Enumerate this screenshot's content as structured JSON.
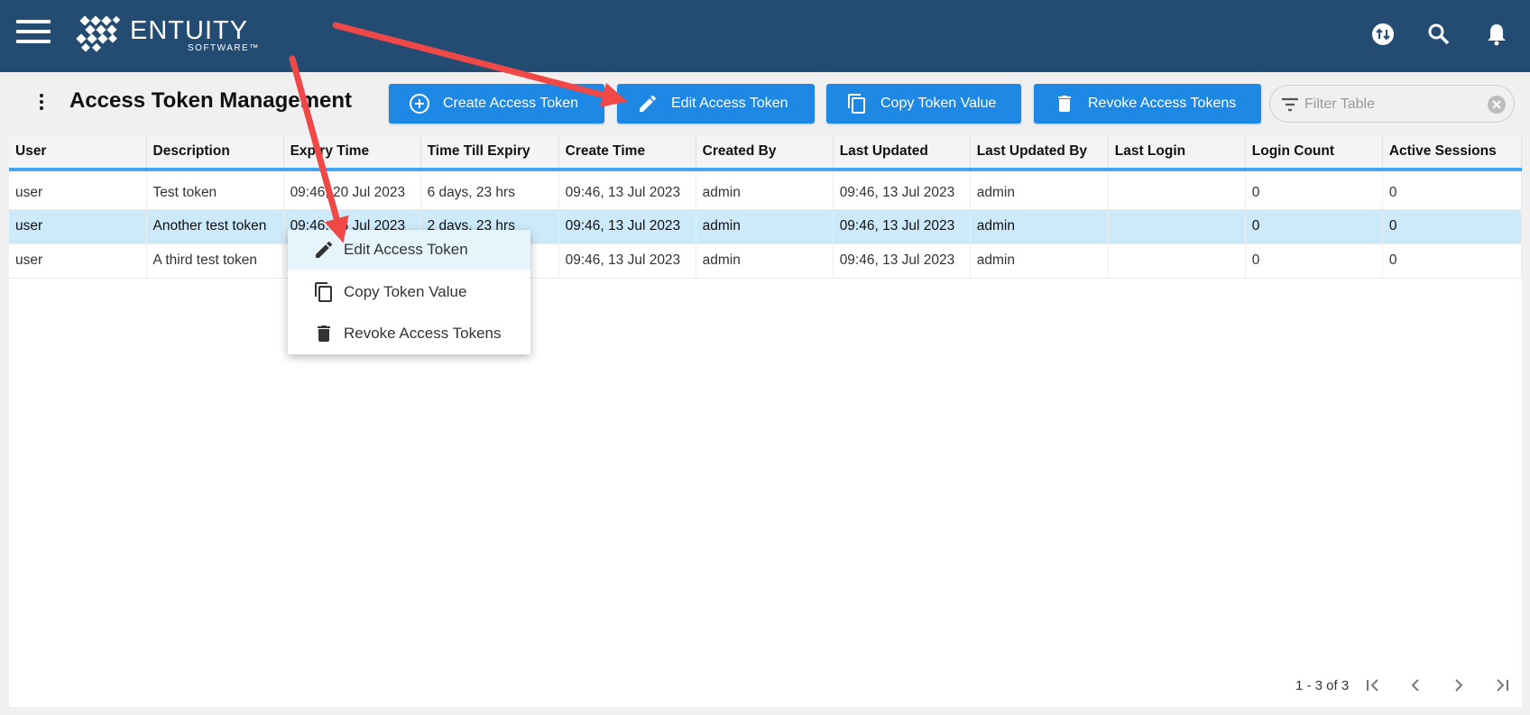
{
  "header": {
    "logo_title": "ENTUITY",
    "logo_sub": "SOFTWARE™"
  },
  "toolbar": {
    "page_title": "Access Token Management",
    "create_label": "Create Access Token",
    "edit_label": "Edit Access Token",
    "copy_label": "Copy Token Value",
    "revoke_label": "Revoke Access Tokens",
    "filter_placeholder": "Filter Table"
  },
  "table": {
    "columns": [
      "User",
      "Description",
      "Expiry Time",
      "Time Till Expiry",
      "Create Time",
      "Created By",
      "Last Updated",
      "Last Updated By",
      "Last Login",
      "Login Count",
      "Active Sessions"
    ],
    "rows": [
      [
        "user",
        "Test token",
        "09:46, 20 Jul 2023",
        "6 days, 23 hrs",
        "09:46, 13 Jul 2023",
        "admin",
        "09:46, 13 Jul 2023",
        "admin",
        "",
        "0",
        "0"
      ],
      [
        "user",
        "Another test token",
        "09:46, 16 Jul 2023",
        "2 days, 23 hrs",
        "09:46, 13 Jul 2023",
        "admin",
        "09:46, 13 Jul 2023",
        "admin",
        "",
        "0",
        "0"
      ],
      [
        "user",
        "A third test token",
        "",
        "",
        "09:46, 13 Jul 2023",
        "admin",
        "09:46, 13 Jul 2023",
        "admin",
        "",
        "0",
        "0"
      ]
    ]
  },
  "context_menu": {
    "items": [
      "Edit Access Token",
      "Copy Token Value",
      "Revoke Access Tokens"
    ]
  },
  "pagination": {
    "range": "1 - 3 of 3"
  },
  "colors": {
    "header_bg": "#244c72",
    "button_bg": "#1e88e5",
    "selected_row": "#cdeafb",
    "annotation_arrow": "#f04747"
  }
}
